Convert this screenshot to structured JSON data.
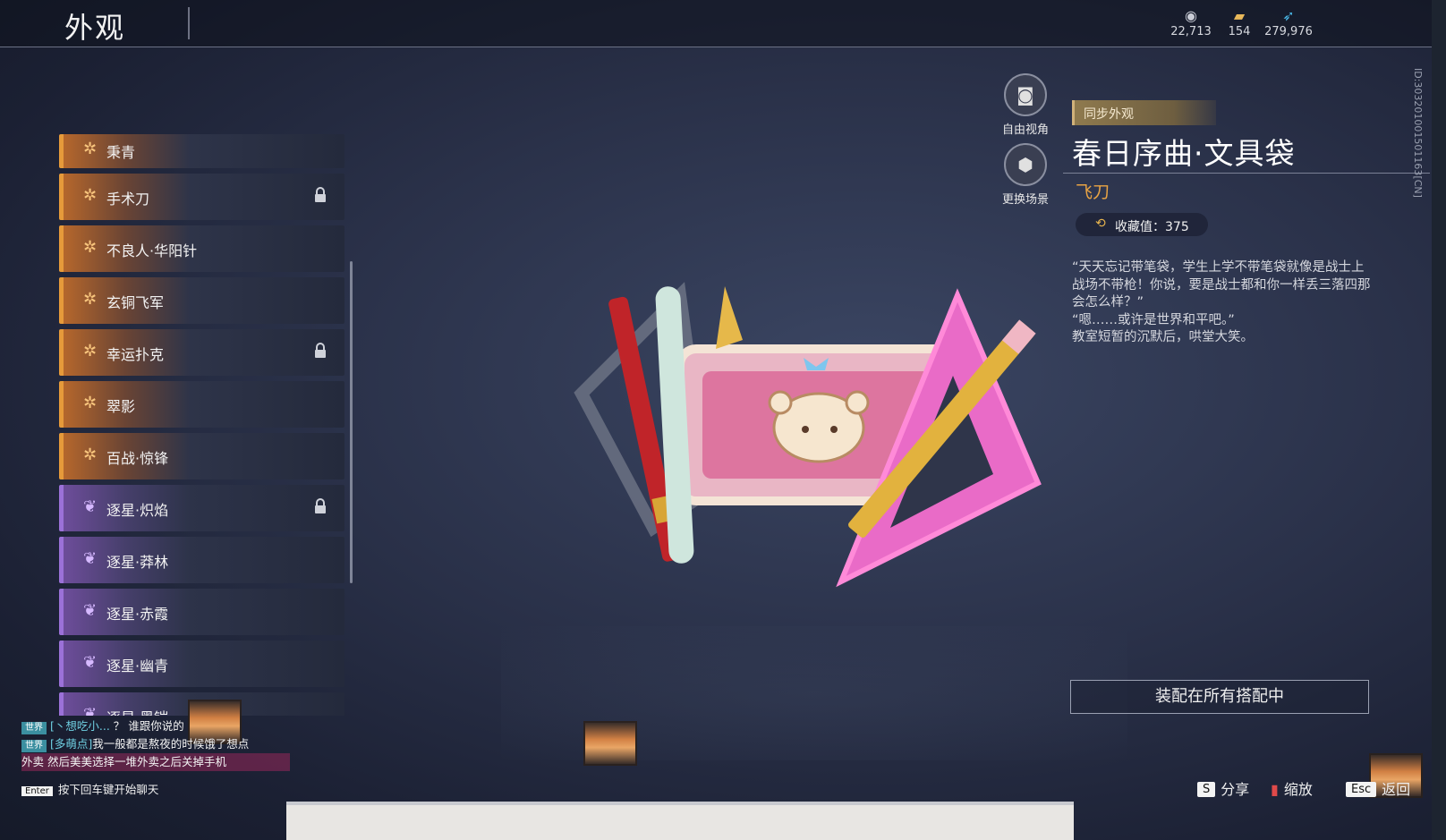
{
  "header": {
    "title": "外观",
    "currencies": [
      {
        "icon": "coin-icon",
        "value": "22,713"
      },
      {
        "icon": "ticket-icon",
        "value": "154"
      },
      {
        "icon": "feather-icon",
        "value": "279,976"
      }
    ]
  },
  "skin_list": [
    {
      "label": "秉青",
      "tier": "gold",
      "locked": false
    },
    {
      "label": "手术刀",
      "tier": "gold",
      "locked": true
    },
    {
      "label": "不良人·华阳针",
      "tier": "gold",
      "locked": false
    },
    {
      "label": "玄铜飞军",
      "tier": "gold",
      "locked": false
    },
    {
      "label": "幸运扑克",
      "tier": "gold",
      "locked": true
    },
    {
      "label": "翠影",
      "tier": "gold",
      "locked": false
    },
    {
      "label": "百战·惊锋",
      "tier": "gold",
      "locked": false
    },
    {
      "label": "逐星·炽焰",
      "tier": "purple",
      "locked": true
    },
    {
      "label": "逐星·莽林",
      "tier": "purple",
      "locked": false
    },
    {
      "label": "逐星·赤霞",
      "tier": "purple",
      "locked": false
    },
    {
      "label": "逐星·幽青",
      "tier": "purple",
      "locked": false
    },
    {
      "label": "逐星·黑铠",
      "tier": "purple",
      "locked": false
    }
  ],
  "view_controls": {
    "free_view": "自由视角",
    "change_scene": "更换场景"
  },
  "detail": {
    "sync_tag": "同步外观",
    "name": "春日序曲·文具袋",
    "type": "飞刀",
    "collect_label": "收藏值：375",
    "description": [
      "“天天忘记带笔袋，学生上学不带笔袋就像是战士上战场不带枪！你说，要是战士都和你一样丢三落四那会怎么样？”",
      "“嗯……或许是世界和平吧。”",
      "教室短暂的沉默后，哄堂大笑。"
    ],
    "side_id": "ID:303201001501163[CN]",
    "equip_button": "装配在所有搭配中"
  },
  "chat": {
    "lines": [
      {
        "tag": "世界",
        "user": "[丶想吃小...",
        "msg": "？ 谁跟你说的"
      },
      {
        "tag": "世界",
        "user": "[多萌点]",
        "msg": "我一般都是熬夜的时候饿了想点"
      },
      {
        "tag": "",
        "user": "",
        "msg": "外卖 然后美美选择一堆外卖之后关掉手机"
      }
    ],
    "enter_key": "Enter",
    "enter_hint": "按下回车键开始聊天"
  },
  "hints": {
    "share_key": "S",
    "share": "分享",
    "zoom": "缩放",
    "back_key": "Esc",
    "back": "返回"
  },
  "colors": {
    "gold_accent": "#e69a3a",
    "purple_accent": "#9b71d8",
    "type_orange": "#e9a444"
  }
}
